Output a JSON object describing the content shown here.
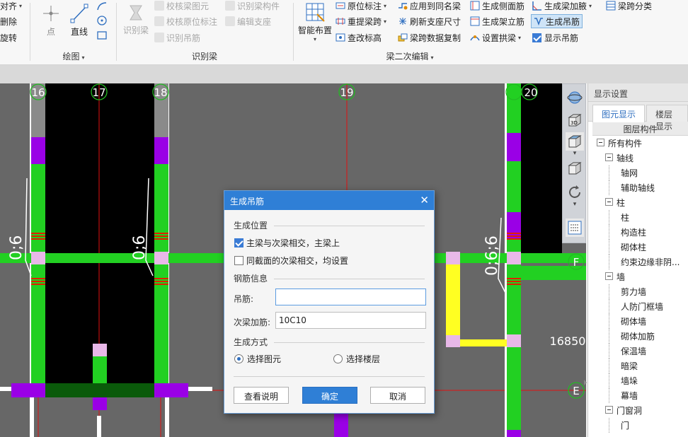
{
  "ribbon": {
    "group0": {
      "items": [
        "对齐",
        "删除",
        "旋转"
      ]
    },
    "draw": {
      "label": "绘图",
      "point": "点",
      "line": "直线"
    },
    "identify": {
      "label": "识别梁",
      "big": "识别梁",
      "items": [
        "校核梁图元",
        "校核原位标注",
        "识别吊筋",
        "识别梁构件",
        "编辑支座"
      ]
    },
    "beam2": {
      "label": "梁二次编辑",
      "big": "智能布置",
      "col1": [
        "原位标注",
        "重提梁跨",
        "查改标高"
      ],
      "col2": [
        "应用到同名梁",
        "刷新支座尺寸",
        "梁跨数据复制"
      ],
      "col3": [
        "生成侧面筋",
        "生成架立筋",
        "设置拱梁"
      ],
      "col4": [
        "生成梁加腋",
        "生成吊筋",
        "显示吊筋"
      ],
      "col5": [
        "梁跨分类"
      ]
    }
  },
  "canvas": {
    "axes": [
      "16",
      "17",
      "18",
      "19",
      "20"
    ],
    "row_labels": [
      "F",
      "E"
    ],
    "dimension": "16850",
    "beam_text": [
      "0;6",
      "0;6",
      "0;6;6"
    ]
  },
  "panel": {
    "title": "显示设置",
    "tabs": [
      "图元显示",
      "楼层显示"
    ],
    "column_header": "图层构件",
    "tree": [
      {
        "label": "所有构件",
        "level": 0,
        "box": true
      },
      {
        "label": "轴线",
        "level": 1,
        "box": true
      },
      {
        "label": "轴网",
        "level": 2,
        "box": false
      },
      {
        "label": "辅助轴线",
        "level": 2,
        "box": false
      },
      {
        "label": "柱",
        "level": 1,
        "box": true
      },
      {
        "label": "柱",
        "level": 2,
        "box": false
      },
      {
        "label": "构造柱",
        "level": 2,
        "box": false
      },
      {
        "label": "砌体柱",
        "level": 2,
        "box": false
      },
      {
        "label": "约束边缘非阴...",
        "level": 2,
        "box": false
      },
      {
        "label": "墙",
        "level": 1,
        "box": true
      },
      {
        "label": "剪力墙",
        "level": 2,
        "box": false
      },
      {
        "label": "人防门框墙",
        "level": 2,
        "box": false
      },
      {
        "label": "砌体墙",
        "level": 2,
        "box": false
      },
      {
        "label": "砌体加筋",
        "level": 2,
        "box": false
      },
      {
        "label": "保温墙",
        "level": 2,
        "box": false
      },
      {
        "label": "暗梁",
        "level": 2,
        "box": false
      },
      {
        "label": "墙垛",
        "level": 2,
        "box": false
      },
      {
        "label": "幕墙",
        "level": 2,
        "box": false
      },
      {
        "label": "门窗洞",
        "level": 1,
        "box": true
      },
      {
        "label": "门",
        "level": 2,
        "box": false
      }
    ]
  },
  "dialog": {
    "title": "生成吊筋",
    "section_position": "生成位置",
    "opt1": "主梁与次梁相交，主梁上",
    "opt2": "同截面的次梁相交，均设置",
    "opt1_checked": true,
    "opt2_checked": false,
    "section_rebar": "钢筋信息",
    "hanger_label": "吊筋:",
    "hanger_value": "",
    "secondary_label": "次梁加筋:",
    "secondary_value": "10C10",
    "section_method": "生成方式",
    "radio1": "选择图元",
    "radio2": "选择楼层",
    "selected_radio": "选择图元",
    "btn_help": "查看说明",
    "btn_ok": "确定",
    "btn_cancel": "取消"
  },
  "colors": {
    "accent": "#2f7fd6",
    "green": "#20d020",
    "purple": "#9a00e6",
    "yellow": "#ffff20",
    "canvas_gray": "#666666"
  }
}
